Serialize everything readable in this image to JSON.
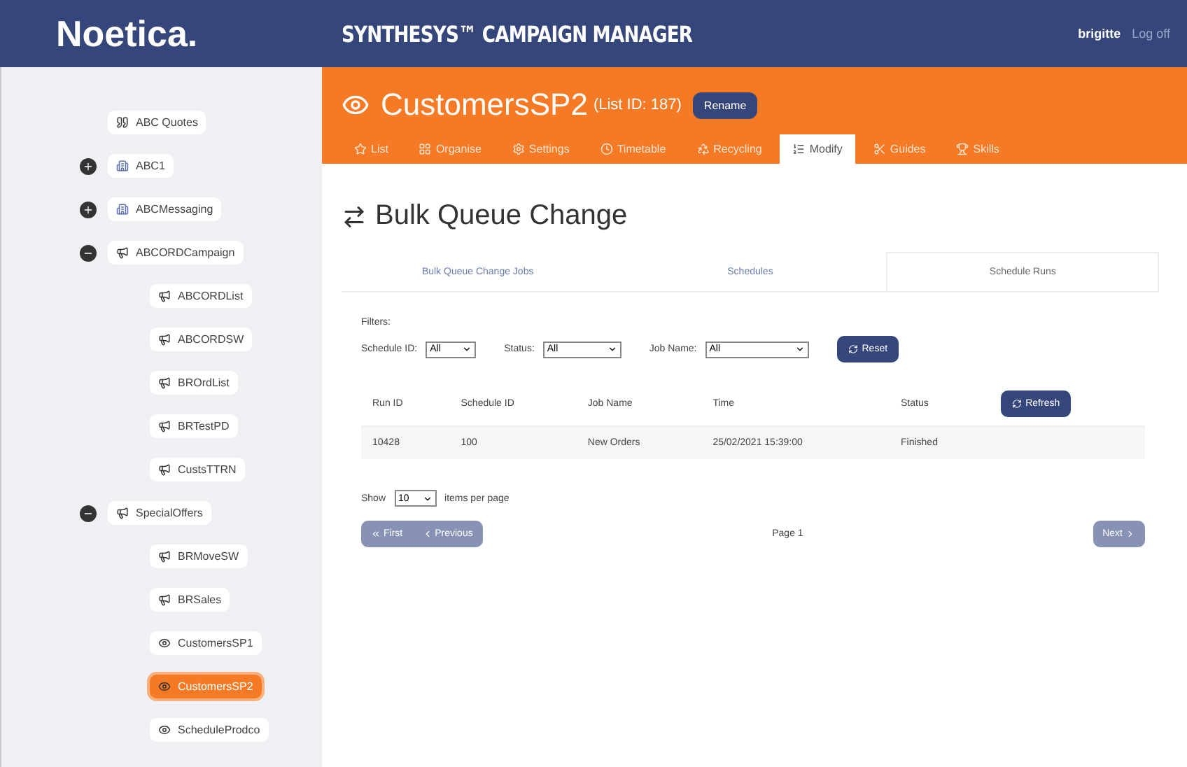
{
  "logo": "Noetica.",
  "header": {
    "title": "SYNTHESYS™ CAMPAIGN MANAGER",
    "user": "brigitte",
    "logout": "Log off"
  },
  "tree": [
    {
      "label": "ABC Quotes",
      "kind": "quotes",
      "selected": false
    },
    {
      "label": "ABC1",
      "kind": "group",
      "expanded": false,
      "selected": false
    },
    {
      "label": "ABCMessaging",
      "kind": "group",
      "expanded": false,
      "selected": false
    },
    {
      "label": "ABCORDCampaign",
      "kind": "campaign",
      "expanded": true,
      "selected": false,
      "children": [
        {
          "label": "ABCORDList",
          "kind": "list",
          "selected": false
        },
        {
          "label": "ABCORDSW",
          "kind": "list",
          "selected": false
        },
        {
          "label": "BROrdList",
          "kind": "list",
          "selected": false
        },
        {
          "label": "BRTestPD",
          "kind": "list",
          "selected": false
        },
        {
          "label": "CustsTTRN",
          "kind": "list",
          "selected": false
        }
      ]
    },
    {
      "label": "SpecialOffers",
      "kind": "campaign",
      "expanded": true,
      "selected": false,
      "children": [
        {
          "label": "BRMoveSW",
          "kind": "list",
          "selected": false
        },
        {
          "label": "BRSales",
          "kind": "list",
          "selected": false
        },
        {
          "label": "CustomersSP1",
          "kind": "view",
          "selected": false
        },
        {
          "label": "CustomersSP2",
          "kind": "view",
          "selected": true
        },
        {
          "label": "ScheduleProdco",
          "kind": "view",
          "selected": false
        }
      ]
    }
  ],
  "list_header": {
    "name": "CustomersSP2",
    "list_id": "(List ID: 187)",
    "rename": "Rename"
  },
  "nav_tabs": [
    {
      "label": "List",
      "selected": false
    },
    {
      "label": "Organise",
      "selected": false
    },
    {
      "label": "Settings",
      "selected": false
    },
    {
      "label": "Timetable",
      "selected": false
    },
    {
      "label": "Recycling",
      "selected": false
    },
    {
      "label": "Modify",
      "selected": true
    },
    {
      "label": "Guides",
      "selected": false
    },
    {
      "label": "Skills",
      "selected": false
    }
  ],
  "page_title": "Bulk Queue Change",
  "sub_tabs": [
    {
      "label": "Bulk Queue Change Jobs",
      "selected": false
    },
    {
      "label": "Schedules",
      "selected": false
    },
    {
      "label": "Schedule Runs",
      "selected": true
    }
  ],
  "filters": {
    "label": "Filters:",
    "fields": [
      {
        "label": "Schedule ID:",
        "value": "All"
      },
      {
        "label": "Status:",
        "value": "All"
      },
      {
        "label": "Job Name:",
        "value": "All"
      }
    ],
    "reset": "Reset"
  },
  "table": {
    "columns": [
      "Run ID",
      "Schedule ID",
      "Job Name",
      "Time",
      "Status"
    ],
    "refresh": "Refresh",
    "rows": [
      [
        "10428",
        "100",
        "New Orders",
        "25/02/2021 15:39:00",
        "Finished"
      ]
    ]
  },
  "paging": {
    "show": "Show",
    "per_page_value": "10",
    "per_page": "items per page",
    "first": "First",
    "previous": "Previous",
    "page": "Page 1",
    "next": "Next"
  }
}
